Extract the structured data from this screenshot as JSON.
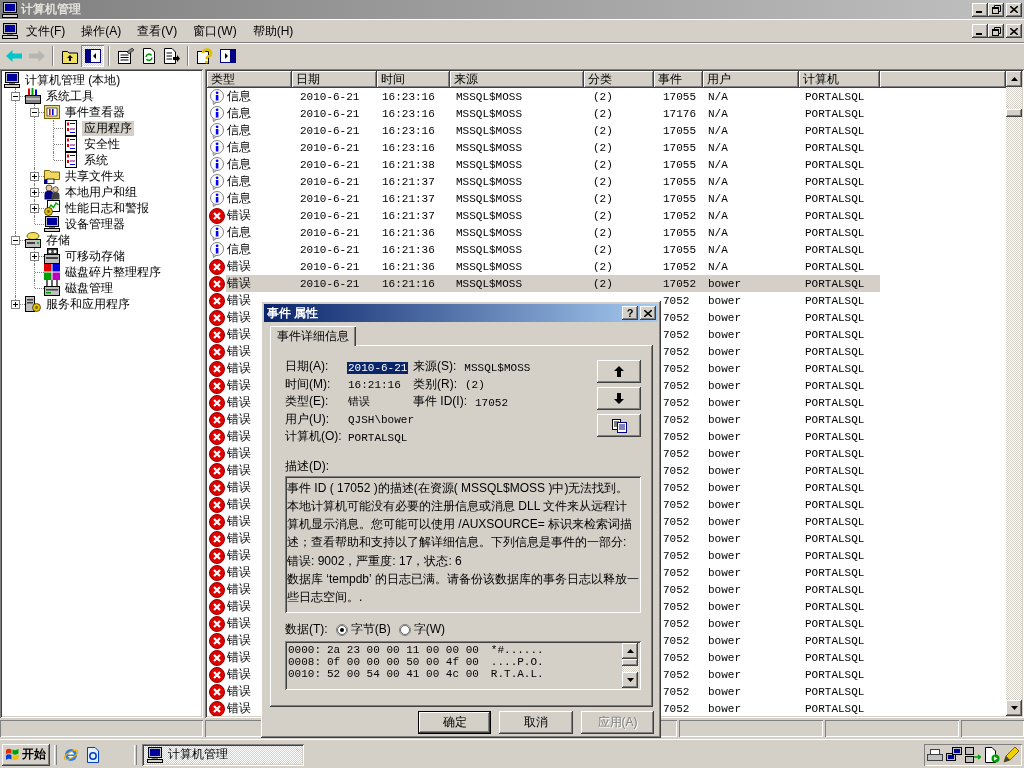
{
  "window": {
    "title": "计算机管理"
  },
  "menu": [
    "文件(F)",
    "操作(A)",
    "查看(V)",
    "窗口(W)",
    "帮助(H)"
  ],
  "toolbar": {
    "groups": [
      {
        "buttons": [
          {
            "kind": "back",
            "disabled": false,
            "pressed": false
          },
          {
            "kind": "forward",
            "disabled": true,
            "pressed": false
          }
        ]
      },
      {
        "buttons": [
          {
            "kind": "up-level",
            "disabled": false,
            "pressed": false
          },
          {
            "kind": "console-tree",
            "disabled": false,
            "pressed": true
          }
        ]
      },
      {
        "buttons": [
          {
            "kind": "properties",
            "disabled": false,
            "pressed": false
          },
          {
            "kind": "refresh",
            "disabled": false,
            "pressed": false
          },
          {
            "kind": "export",
            "disabled": false,
            "pressed": false
          }
        ]
      },
      {
        "buttons": [
          {
            "kind": "help",
            "disabled": false,
            "pressed": false
          },
          {
            "kind": "action-pane",
            "disabled": false,
            "pressed": false
          }
        ]
      }
    ]
  },
  "tree": [
    {
      "label": "计算机管理 (本地)",
      "kind": "computer",
      "selected": false,
      "children": [
        {
          "label": "系统工具",
          "kind": "tools",
          "selected": false,
          "expanded": true,
          "children": [
            {
              "label": "事件查看器",
              "kind": "event-viewer",
              "selected": false,
              "expanded": true,
              "children": [
                {
                  "label": "应用程序",
                  "kind": "log",
                  "selected": true
                },
                {
                  "label": "安全性",
                  "kind": "log",
                  "selected": false
                },
                {
                  "label": "系统",
                  "kind": "log",
                  "selected": false
                }
              ]
            },
            {
              "label": "共享文件夹",
              "kind": "shared-folder",
              "selected": false,
              "expanded": false
            },
            {
              "label": "本地用户和组",
              "kind": "users",
              "selected": false,
              "expanded": false
            },
            {
              "label": "性能日志和警报",
              "kind": "performance",
              "selected": false,
              "expanded": false
            },
            {
              "label": "设备管理器",
              "kind": "device-manager",
              "selected": false
            }
          ]
        },
        {
          "label": "存储",
          "kind": "storage",
          "selected": false,
          "expanded": true,
          "children": [
            {
              "label": "可移动存储",
              "kind": "removable-storage",
              "selected": false,
              "expanded": false
            },
            {
              "label": "磁盘碎片整理程序",
              "kind": "defragmenter",
              "selected": false
            },
            {
              "label": "磁盘管理",
              "kind": "disk-management",
              "selected": false
            }
          ]
        },
        {
          "label": "服务和应用程序",
          "kind": "services",
          "selected": false,
          "expanded": false
        }
      ]
    }
  ],
  "list": {
    "columns": [
      "类型",
      "日期",
      "时间",
      "来源",
      "分类",
      "事件",
      "用户",
      "计算机"
    ],
    "rows": [
      {
        "kind": "info",
        "type": "信息",
        "date": "2010-6-21",
        "time": "16:23:16",
        "source": "MSSQL$MOSS",
        "category": "(2)",
        "event": "17055",
        "user": "N/A",
        "computer": "PORTALSQL",
        "selected": false
      },
      {
        "kind": "info",
        "type": "信息",
        "date": "2010-6-21",
        "time": "16:23:16",
        "source": "MSSQL$MOSS",
        "category": "(2)",
        "event": "17176",
        "user": "N/A",
        "computer": "PORTALSQL",
        "selected": false
      },
      {
        "kind": "info",
        "type": "信息",
        "date": "2010-6-21",
        "time": "16:23:16",
        "source": "MSSQL$MOSS",
        "category": "(2)",
        "event": "17055",
        "user": "N/A",
        "computer": "PORTALSQL",
        "selected": false
      },
      {
        "kind": "info",
        "type": "信息",
        "date": "2010-6-21",
        "time": "16:23:16",
        "source": "MSSQL$MOSS",
        "category": "(2)",
        "event": "17055",
        "user": "N/A",
        "computer": "PORTALSQL",
        "selected": false
      },
      {
        "kind": "info",
        "type": "信息",
        "date": "2010-6-21",
        "time": "16:21:38",
        "source": "MSSQL$MOSS",
        "category": "(2)",
        "event": "17055",
        "user": "N/A",
        "computer": "PORTALSQL",
        "selected": false
      },
      {
        "kind": "info",
        "type": "信息",
        "date": "2010-6-21",
        "time": "16:21:37",
        "source": "MSSQL$MOSS",
        "category": "(2)",
        "event": "17055",
        "user": "N/A",
        "computer": "PORTALSQL",
        "selected": false
      },
      {
        "kind": "info",
        "type": "信息",
        "date": "2010-6-21",
        "time": "16:21:37",
        "source": "MSSQL$MOSS",
        "category": "(2)",
        "event": "17055",
        "user": "N/A",
        "computer": "PORTALSQL",
        "selected": false
      },
      {
        "kind": "error",
        "type": "错误",
        "date": "2010-6-21",
        "time": "16:21:37",
        "source": "MSSQL$MOSS",
        "category": "(2)",
        "event": "17052",
        "user": "N/A",
        "computer": "PORTALSQL",
        "selected": false
      },
      {
        "kind": "info",
        "type": "信息",
        "date": "2010-6-21",
        "time": "16:21:36",
        "source": "MSSQL$MOSS",
        "category": "(2)",
        "event": "17055",
        "user": "N/A",
        "computer": "PORTALSQL",
        "selected": false
      },
      {
        "kind": "info",
        "type": "信息",
        "date": "2010-6-21",
        "time": "16:21:36",
        "source": "MSSQL$MOSS",
        "category": "(2)",
        "event": "17055",
        "user": "N/A",
        "computer": "PORTALSQL",
        "selected": false
      },
      {
        "kind": "error",
        "type": "错误",
        "date": "2010-6-21",
        "time": "16:21:36",
        "source": "MSSQL$MOSS",
        "category": "(2)",
        "event": "17052",
        "user": "N/A",
        "computer": "PORTALSQL",
        "selected": false
      },
      {
        "kind": "error",
        "type": "错误",
        "date": "2010-6-21",
        "time": "16:21:16",
        "source": "MSSQL$MOSS",
        "category": "(2)",
        "event": "17052",
        "user": "bower",
        "computer": "PORTALSQL",
        "selected": true
      },
      {
        "kind": "error",
        "type": "错误",
        "event": "7052",
        "user": "bower",
        "computer": "PORTALSQL",
        "selected": false
      },
      {
        "kind": "error",
        "type": "错误",
        "event": "7052",
        "user": "bower",
        "computer": "PORTALSQL",
        "selected": false
      },
      {
        "kind": "error",
        "type": "错误",
        "event": "7052",
        "user": "bower",
        "computer": "PORTALSQL",
        "selected": false
      },
      {
        "kind": "error",
        "type": "错误",
        "event": "7052",
        "user": "bower",
        "computer": "PORTALSQL",
        "selected": false
      },
      {
        "kind": "error",
        "type": "错误",
        "event": "7052",
        "user": "bower",
        "computer": "PORTALSQL",
        "selected": false
      },
      {
        "kind": "error",
        "type": "错误",
        "event": "7052",
        "user": "bower",
        "computer": "PORTALSQL",
        "selected": false
      },
      {
        "kind": "error",
        "type": "错误",
        "event": "7052",
        "user": "bower",
        "computer": "PORTALSQL",
        "selected": false
      },
      {
        "kind": "error",
        "type": "错误",
        "event": "7052",
        "user": "bower",
        "computer": "PORTALSQL",
        "selected": false
      },
      {
        "kind": "error",
        "type": "错误",
        "event": "7052",
        "user": "bower",
        "computer": "PORTALSQL",
        "selected": false
      },
      {
        "kind": "error",
        "type": "错误",
        "event": "7052",
        "user": "bower",
        "computer": "PORTALSQL",
        "selected": false
      },
      {
        "kind": "error",
        "type": "错误",
        "event": "7052",
        "user": "bower",
        "computer": "PORTALSQL",
        "selected": false
      },
      {
        "kind": "error",
        "type": "错误",
        "event": "7052",
        "user": "bower",
        "computer": "PORTALSQL",
        "selected": false
      },
      {
        "kind": "error",
        "type": "错误",
        "event": "7052",
        "user": "bower",
        "computer": "PORTALSQL",
        "selected": false
      },
      {
        "kind": "error",
        "type": "错误",
        "event": "7052",
        "user": "bower",
        "computer": "PORTALSQL",
        "selected": false
      },
      {
        "kind": "error",
        "type": "错误",
        "event": "7052",
        "user": "bower",
        "computer": "PORTALSQL",
        "selected": false
      },
      {
        "kind": "error",
        "type": "错误",
        "event": "7052",
        "user": "bower",
        "computer": "PORTALSQL",
        "selected": false
      },
      {
        "kind": "error",
        "type": "错误",
        "event": "7052",
        "user": "bower",
        "computer": "PORTALSQL",
        "selected": false
      },
      {
        "kind": "error",
        "type": "错误",
        "event": "7052",
        "user": "bower",
        "computer": "PORTALSQL",
        "selected": false
      },
      {
        "kind": "error",
        "type": "错误",
        "event": "7052",
        "user": "bower",
        "computer": "PORTALSQL",
        "selected": false
      },
      {
        "kind": "error",
        "type": "错误",
        "event": "7052",
        "user": "bower",
        "computer": "PORTALSQL",
        "selected": false
      },
      {
        "kind": "error",
        "type": "错误",
        "event": "7052",
        "user": "bower",
        "computer": "PORTALSQL",
        "selected": false
      },
      {
        "kind": "error",
        "type": "错误",
        "event": "7052",
        "user": "bower",
        "computer": "PORTALSQL",
        "selected": false
      },
      {
        "kind": "error",
        "type": "错误",
        "event": "7052",
        "user": "bower",
        "computer": "PORTALSQL",
        "selected": false
      },
      {
        "kind": "error",
        "type": "错误",
        "event": "7052",
        "user": "bower",
        "computer": "PORTALSQL",
        "selected": false
      },
      {
        "kind": "error",
        "type": "错误",
        "event": "7052",
        "user": "bower",
        "computer": "PORTALSQL",
        "selected": false
      }
    ]
  },
  "dialog": {
    "title": "事件 属性",
    "help_button": "?",
    "tabs": [
      {
        "label": "事件详细信息",
        "selected": true
      }
    ],
    "field_rows": [
      {
        "fields": [
          {
            "label": "日期(A):",
            "value": "2010-6-21",
            "selected": true
          },
          {
            "label": "来源(S):",
            "value": "MSSQL$MOSS",
            "selected": false
          }
        ]
      },
      {
        "fields": [
          {
            "label": "时间(M):",
            "value": "16:21:16",
            "selected": false
          },
          {
            "label": "类别(R):",
            "value": "(2)",
            "selected": false
          }
        ]
      },
      {
        "fields": [
          {
            "label": "类型(E):",
            "value": "错误",
            "selected": false
          },
          {
            "label": "事件 ID(I):",
            "value": "17052",
            "selected": false
          }
        ]
      },
      {
        "fields": [
          {
            "label": "用户(U):",
            "value": "QJSH\\bower",
            "selected": false
          }
        ]
      },
      {
        "fields": [
          {
            "label": "计算机(O):",
            "value": "PORTALSQL",
            "selected": false
          }
        ]
      }
    ],
    "description_label": "描述(D):",
    "description": "事件 ID ( 17052 )的描述(在资源( MSSQL$MOSS )中)无法找到。本地计算机可能没有必要的注册信息或消息 DLL 文件来从远程计算机显示消息。您可能可以使用 /AUXSOURCE= 标识来检索词描述；查看帮助和支持以了解详细信息。下列信息是事件的一部分: 错误: 9002，严重度: 17，状态: 6\n数据库 ‘tempdb’ 的日志已满。请备份该数据库的事务日志以释放一些日志空间。.",
    "data_label": "数据(T):",
    "data_formats": [
      {
        "label": "字节(B)",
        "selected": true
      },
      {
        "label": "字(W)",
        "selected": false
      }
    ],
    "data_lines": [
      {
        "offset": "0000:",
        "bytes": "2a 23 00 00 11 00 00 00",
        "text": "*#......"
      },
      {
        "offset": "0008:",
        "bytes": "0f 00 00 00 50 00 4f 00",
        "text": "....P.O."
      },
      {
        "offset": "0010:",
        "bytes": "52 00 54 00 41 00 4c 00",
        "text": "R.T.A.L."
      }
    ],
    "buttons": [
      {
        "label": "确定",
        "default": true,
        "disabled": false
      },
      {
        "label": "取消",
        "default": false,
        "disabled": false
      },
      {
        "label": "应用(A)",
        "default": false,
        "disabled": true
      }
    ]
  },
  "taskbar": {
    "start": "开始",
    "tasks": [
      {
        "label": "计算机管理",
        "selected": true
      }
    ]
  }
}
